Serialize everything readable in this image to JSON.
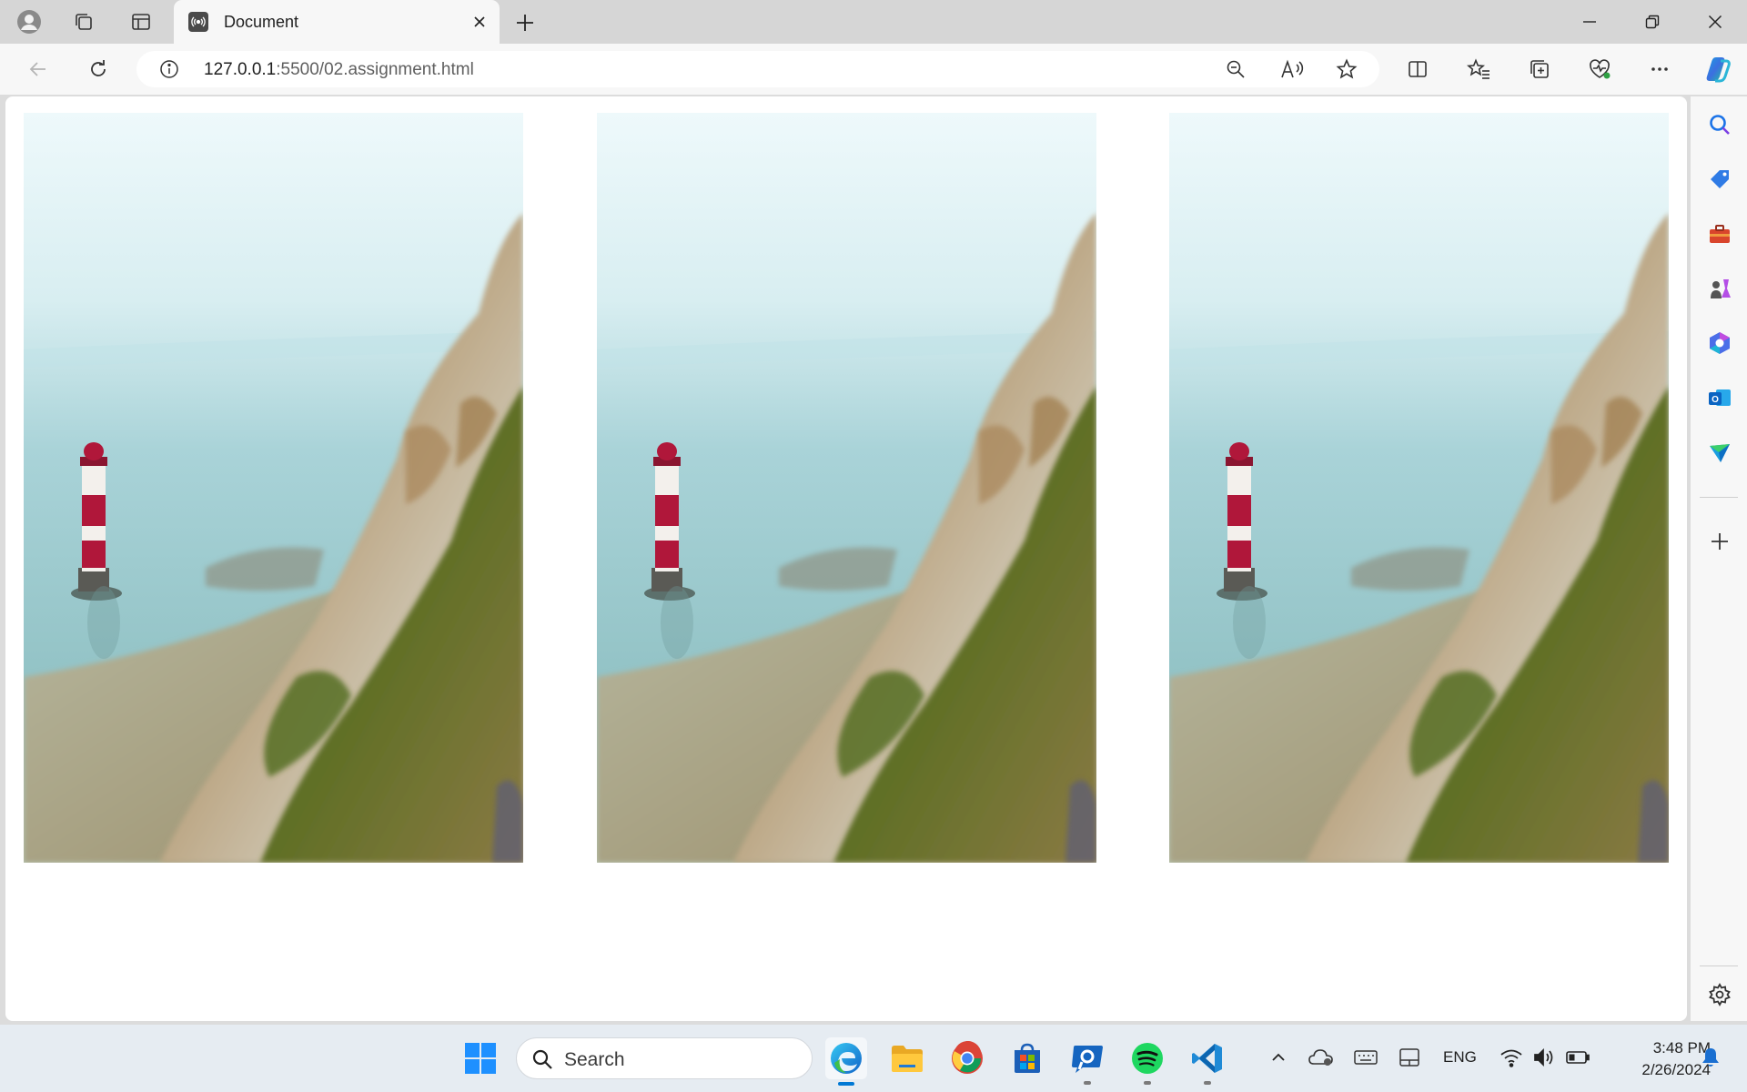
{
  "browser": {
    "tab": {
      "title": "Document",
      "favicon": "broadcast-icon"
    },
    "address": {
      "host": "127.0.0.1",
      "path": ":5500/02.assignment.html"
    },
    "window_controls": [
      "minimize-icon",
      "restore-icon",
      "close-icon"
    ]
  },
  "page": {
    "images": [
      {
        "alt": "lighthouse-cliff-photo"
      },
      {
        "alt": "lighthouse-cliff-photo"
      },
      {
        "alt": "lighthouse-cliff-photo"
      }
    ]
  },
  "sidebar": {
    "items": [
      "search-icon",
      "shopping-tag-icon",
      "tools-icon",
      "games-icon",
      "microsoft-365-icon",
      "outlook-icon",
      "drop-icon",
      "add-icon",
      "settings-icon"
    ]
  },
  "taskbar": {
    "search_placeholder": "Search",
    "apps": [
      "windows-start-icon",
      "edge-icon",
      "file-explorer-icon",
      "chrome-icon",
      "store-icon",
      "remote-icon",
      "spotify-icon",
      "vscode-icon"
    ],
    "tray": {
      "language": "ENG",
      "time": "3:48 PM",
      "date": "2/26/2024"
    }
  },
  "colors": {
    "accent": "#0078d4",
    "sky": "#e6f4f6",
    "sea": "#8ec3c8",
    "cliff": "#b9aa92",
    "grass": "#6b7a2a",
    "lighthouse_red": "#b0173a"
  }
}
